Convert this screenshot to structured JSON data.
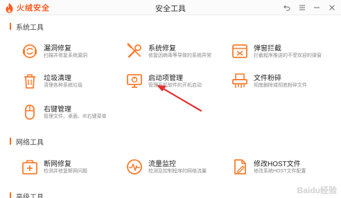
{
  "window": {
    "brand": "火绒安全",
    "title": "安全工具",
    "accent_color": "#ff6a1a",
    "controls": [
      "back-icon",
      "menu-icon",
      "minimize-icon",
      "close-icon"
    ]
  },
  "sections": [
    {
      "title": "系统工具",
      "tools": [
        {
          "name": "漏洞修复",
          "desc": "扫描并修复系统漏洞",
          "icon": "shield-refresh-icon"
        },
        {
          "name": "系统修复",
          "desc": "修复因病毒等导致的系统异常",
          "icon": "wrench-screwdriver-icon"
        },
        {
          "name": "弹窗拦截",
          "desc": "拦截程序推送的不受欢迎的弹窗",
          "icon": "popup-block-icon"
        },
        {
          "name": "垃圾清理",
          "desc": "清理各种系统垃圾",
          "icon": "trash-icon"
        },
        {
          "name": "启动项管理",
          "desc": "管理开机软件的开机启动",
          "icon": "startup-monitor-icon"
        },
        {
          "name": "文件粉碎",
          "desc": "彻底删除或彻底粉碎文件",
          "icon": "shredder-icon"
        },
        {
          "name": "右键管理",
          "desc": "管理文件、桌面、IE右键菜单",
          "icon": "mouse-icon"
        }
      ]
    },
    {
      "title": "网络工具",
      "tools": [
        {
          "name": "断网修复",
          "desc": "检测并修复断网问题",
          "icon": "network-repair-icon"
        },
        {
          "name": "流量监控",
          "desc": "检测及控制程序的网络流量",
          "icon": "traffic-monitor-icon"
        },
        {
          "name": "修改HOST文件",
          "desc": "修改系统HOST文件配置",
          "icon": "host-file-icon"
        }
      ]
    },
    {
      "title": "高级工具",
      "tools": []
    }
  ],
  "watermark": "Baidu经验"
}
